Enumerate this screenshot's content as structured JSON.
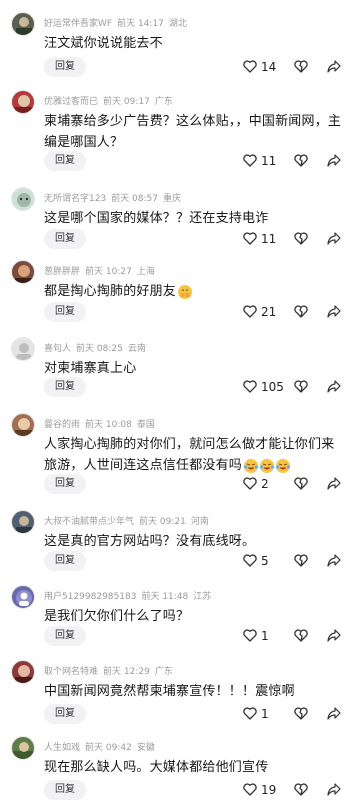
{
  "comments": [
    {
      "user": "好运常伴吾家WF",
      "time": "前天 14:17",
      "location": "湖北",
      "text": "汪文斌你说说能去不",
      "reply_label": "回复",
      "likes": "14",
      "avatar_color": "#5a5f52"
    },
    {
      "user": "优雅过客而已",
      "time": "前天 09:17",
      "location": "广东",
      "text": "柬埔寨给多少广告费？这么体贴，，中国新闻网，主编是哪国人？",
      "reply_label": "回复",
      "likes": "11",
      "avatar_color": "#b23a3a"
    },
    {
      "user": "无所谓名字123",
      "time": "前天 08:57",
      "location": "重庆",
      "text": "这是哪个国家的媒体？？还在支持电诈",
      "reply_label": "回复",
      "likes": "11",
      "avatar_color": "#9fb7a8"
    },
    {
      "user": "葱胖胖胖",
      "time": "前天 10:27",
      "location": "上海",
      "text": "都是掏心掏肺的好朋友",
      "reply_label": "回复",
      "likes": "21",
      "avatar_color": "#7a4a3a"
    },
    {
      "user": "喜句人",
      "time": "前天 08:25",
      "location": "云南",
      "text": "对柬埔寨真上心",
      "reply_label": "回复",
      "likes": "105",
      "avatar_color": "#d8d8d8"
    },
    {
      "user": "曼谷的雨",
      "time": "前天 10:08",
      "location": "泰国",
      "text": "人家掏心掏肺的对你们，就问怎么做才能让你们来旅游，人世间连这点信任都没有吗",
      "reply_label": "回复",
      "likes": "2",
      "avatar_color": "#a07050"
    },
    {
      "user": "大叔不油腻带点少年气",
      "time": "前天 09:21",
      "location": "河南",
      "text": "这是真的官方网站吗？没有底线呀。",
      "reply_label": "回复",
      "likes": "5",
      "avatar_color": "#506070"
    },
    {
      "user": "用户5129982985183",
      "time": "前天 11:48",
      "location": "江苏",
      "text": "是我们欠你们什么了吗？",
      "reply_label": "回复",
      "likes": "1",
      "avatar_color": "#6a6aa8"
    },
    {
      "user": "取个网名特难",
      "time": "前天 12:29",
      "location": "广东",
      "text": "中国新闻网竟然帮柬埔寨宣传！！！震惊啊",
      "reply_label": "回复",
      "likes": "1",
      "avatar_color": "#8a3a3a"
    },
    {
      "user": "人生如戏",
      "time": "前天 09:42",
      "location": "安徽",
      "text": "现在那么缺人吗。大媒体都给他们宣传",
      "reply_label": "回复",
      "likes": "19",
      "avatar_color": "#5f7d4a"
    }
  ]
}
